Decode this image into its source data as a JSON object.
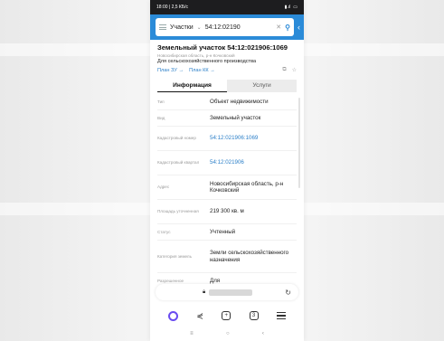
{
  "status": {
    "time_info": "18:00 | 2,5 КБ/с",
    "signal": "▮.ıl",
    "battery": "▭"
  },
  "search": {
    "type": "Участки",
    "value": "54:12:02190",
    "back": "‹"
  },
  "parcel": {
    "title": "Земельный участок 54:12:021906:1069",
    "subtitle": "Новосибирская область, р-н Кочковский",
    "purpose": "Для сельскохозяйственного производства",
    "link_plan_zu": "План ЗУ →",
    "link_plan_kk": "План КК →"
  },
  "tabs": {
    "info": "Информация",
    "services": "Услуги"
  },
  "rows": [
    {
      "k": "Тип",
      "v": "Объект недвижимости",
      "link": false
    },
    {
      "k": "Вид",
      "v": "Земельный участок",
      "link": false
    },
    {
      "k": "Кадастровый номер",
      "v": "54:12:021906:1069",
      "link": true
    },
    {
      "k": "Кадастровый квартал",
      "v": "54:12:021906",
      "link": true
    },
    {
      "k": "Адрес",
      "v": "Новосибирская область, р-н Кочковский",
      "link": false
    },
    {
      "k": "Площадь уточненная",
      "v": "219 300 кв. м",
      "link": false
    },
    {
      "k": "Статус",
      "v": "Учтенный",
      "link": false
    },
    {
      "k": "Категория земель",
      "v": "Земли сельскохозяйственного назначения",
      "link": false
    },
    {
      "k": "Разрешенное",
      "v": "Для",
      "link": false
    }
  ],
  "browser": {
    "tabs_count": "3"
  },
  "colors": {
    "accent": "#2b8bd8",
    "link": "#2b7fc8",
    "alice": "#6a4cf0"
  }
}
